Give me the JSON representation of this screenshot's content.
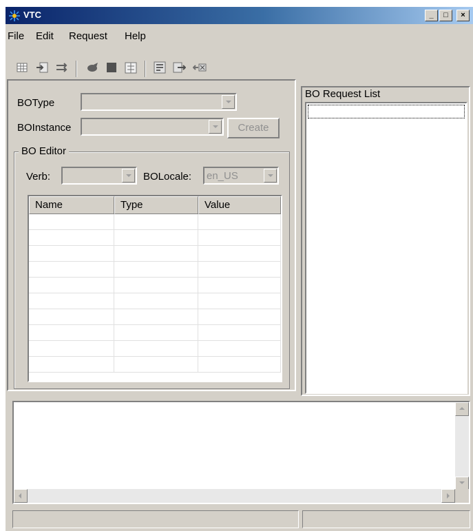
{
  "window": {
    "title": "VTC",
    "minimize": "_",
    "maximize": "□",
    "close": "×"
  },
  "menu": [
    "File",
    "Edit",
    "Request",
    "Help"
  ],
  "toolbar": {
    "icons": [
      "grid-icon",
      "import-icon",
      "transfer-icon",
      "send-icon",
      "stop-icon",
      "exchange-icon",
      "properties-icon",
      "export-icon",
      "delete-icon"
    ]
  },
  "form": {
    "botype_label": "BOType",
    "botype_value": "",
    "boinstance_label": "BOInstance",
    "boinstance_value": "",
    "create_label": "Create"
  },
  "editor": {
    "group_label": "BO Editor",
    "verb_label": "Verb:",
    "verb_value": "",
    "locale_label": "BOLocale:",
    "locale_value": "en_US",
    "columns": [
      "Name",
      "Type",
      "Value"
    ],
    "rows": [
      [
        "",
        "",
        ""
      ],
      [
        "",
        "",
        ""
      ],
      [
        "",
        "",
        ""
      ],
      [
        "",
        "",
        ""
      ],
      [
        "",
        "",
        ""
      ],
      [
        "",
        "",
        ""
      ],
      [
        "",
        "",
        ""
      ],
      [
        "",
        "",
        ""
      ],
      [
        "",
        "",
        ""
      ],
      [
        "",
        "",
        ""
      ]
    ]
  },
  "request_list": {
    "title": "BO Request List",
    "items": []
  },
  "output": {
    "text": ""
  },
  "status": {
    "left": "",
    "right": ""
  },
  "colors": {
    "window_bg": "#d4d0c8",
    "title_start": "#0a246a",
    "title_end": "#a6caf0"
  }
}
